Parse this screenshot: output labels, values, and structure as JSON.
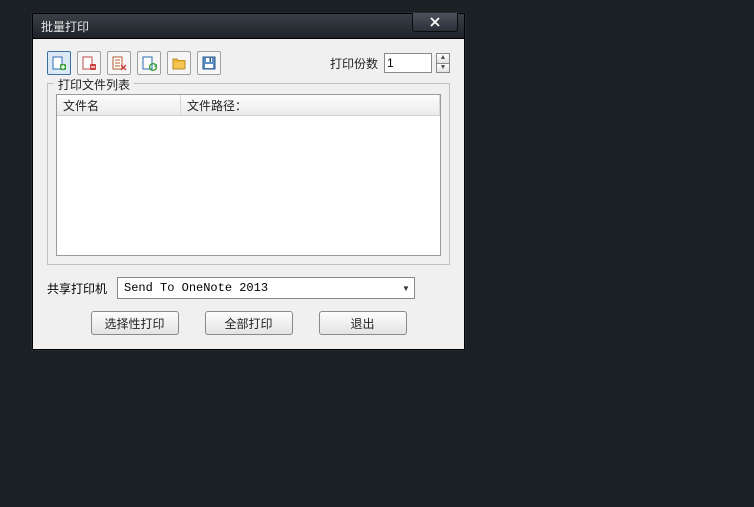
{
  "dialog": {
    "title": "批量打印"
  },
  "copies": {
    "label": "打印份数",
    "value": "1"
  },
  "list": {
    "group_title": "打印文件列表",
    "col_name": "文件名",
    "col_path": "文件路径："
  },
  "printer": {
    "label": "共享打印机",
    "selected": "Send To OneNote 2013"
  },
  "buttons": {
    "selective": "选择性打印",
    "all": "全部打印",
    "exit": "退出"
  }
}
